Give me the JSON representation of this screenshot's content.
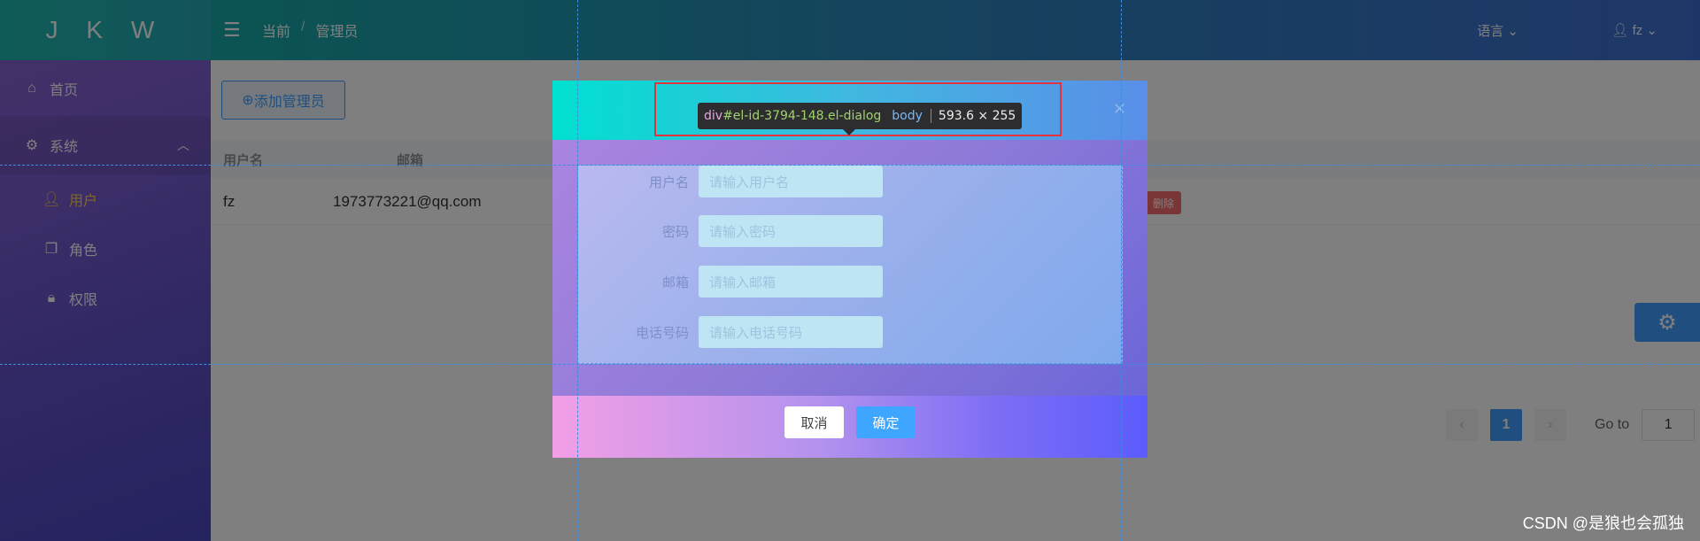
{
  "app": {
    "logo": "J K W"
  },
  "sidebar": {
    "home": "首页",
    "system": "系统",
    "sub_items": [
      "用户",
      "角色",
      "权限"
    ]
  },
  "header": {
    "breadcrumb": [
      "当前",
      "管理员"
    ],
    "breadcrumb_sep": "/",
    "language": "语言",
    "user": "fz"
  },
  "main": {
    "add_button": "添加管理员",
    "columns": [
      "用户名",
      "邮箱"
    ],
    "row": {
      "username": "fz",
      "email": "1973773221@qq.com",
      "delete_label": "删除"
    },
    "pagination": {
      "current_page": "1",
      "goto_label": "Go to",
      "goto_value": "1"
    }
  },
  "dialog": {
    "fields": [
      {
        "label": "用户名",
        "placeholder": "请输入用户名"
      },
      {
        "label": "密码",
        "placeholder": "请输入密码"
      },
      {
        "label": "邮箱",
        "placeholder": "请输入邮箱"
      },
      {
        "label": "电话号码",
        "placeholder": "请输入电话号码"
      }
    ],
    "cancel": "取消",
    "confirm": "确定"
  },
  "devtools": {
    "tag": "div",
    "selector": "#el-id-3794-148.el-dialog",
    "context": "body",
    "dims": "593.6 × 255"
  },
  "watermark": "CSDN @是狼也会孤独",
  "colors": {
    "accent": "#409eff",
    "active_menu": "#ffd04b",
    "danger": "#f56c6c"
  }
}
